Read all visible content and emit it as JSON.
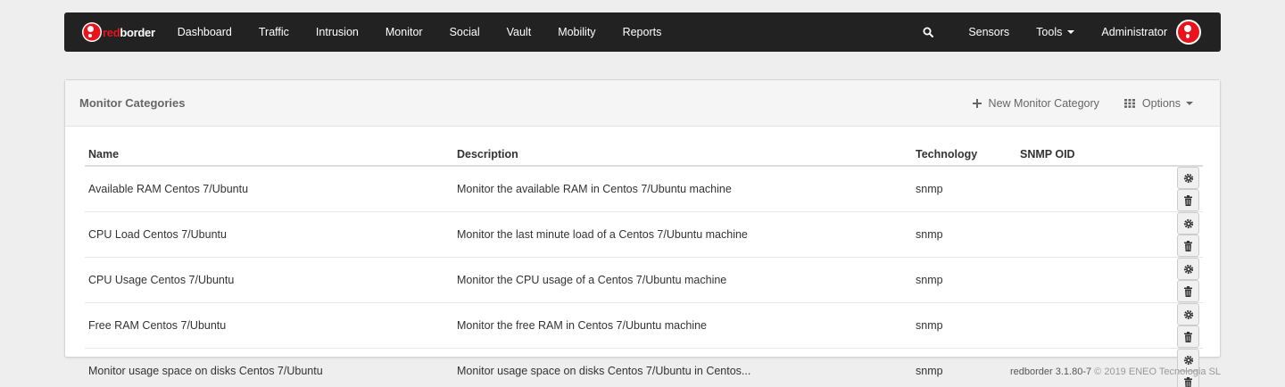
{
  "navbar": {
    "brand_red": "red",
    "brand_white": "border",
    "items": [
      "Dashboard",
      "Traffic",
      "Intrusion",
      "Monitor",
      "Social",
      "Vault",
      "Mobility",
      "Reports"
    ],
    "sensors": "Sensors",
    "tools": "Tools",
    "user": "Administrator"
  },
  "panel": {
    "title": "Monitor Categories",
    "new_label": "New Monitor Category",
    "options_label": "Options"
  },
  "table": {
    "headers": {
      "name": "Name",
      "description": "Description",
      "technology": "Technology",
      "snmp_oid": "SNMP OID"
    },
    "rows": [
      {
        "name": "Available RAM Centos 7/Ubuntu",
        "description": "Monitor the available RAM in Centos 7/Ubuntu machine",
        "technology": "snmp",
        "snmp_oid": ""
      },
      {
        "name": "CPU Load Centos 7/Ubuntu",
        "description": "Monitor the last minute load of a Centos 7/Ubuntu machine",
        "technology": "snmp",
        "snmp_oid": ""
      },
      {
        "name": "CPU Usage Centos 7/Ubuntu",
        "description": "Monitor the CPU usage of a Centos 7/Ubuntu machine",
        "technology": "snmp",
        "snmp_oid": ""
      },
      {
        "name": "Free RAM Centos 7/Ubuntu",
        "description": "Monitor the free RAM in Centos 7/Ubuntu machine",
        "technology": "snmp",
        "snmp_oid": ""
      },
      {
        "name": "Monitor usage space on disks Centos 7/Ubuntu",
        "description": "Monitor usage space on disks Centos 7/Ubuntu in Centos...",
        "technology": "snmp",
        "snmp_oid": ""
      }
    ]
  },
  "footer": {
    "version": "redborder 3.1.80-7",
    "copyright": "© 2019 ENEO Tecnologia SL"
  },
  "colors": {
    "brand_red": "#e8131b",
    "navbar_bg": "#222222"
  }
}
